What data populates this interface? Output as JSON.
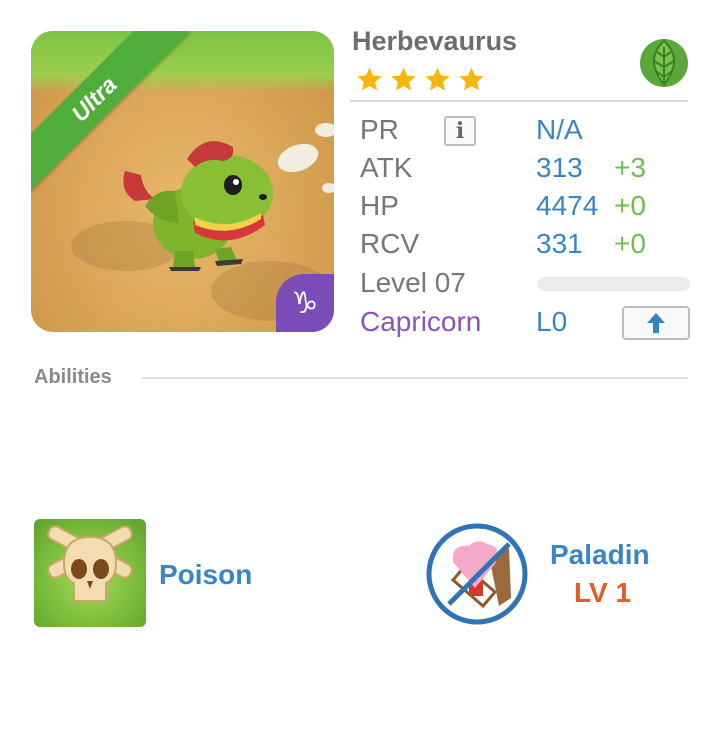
{
  "monster": {
    "name": "Herbevaurus",
    "rarity": "Ultra",
    "stars": 4,
    "element_icon": "leaf-icon",
    "zodiac_symbol": "♑"
  },
  "stats": {
    "pr": {
      "label": "PR",
      "value": "N/A"
    },
    "atk": {
      "label": "ATK",
      "value": "313",
      "bonus": "+3"
    },
    "hp": {
      "label": "HP",
      "value": "4474",
      "bonus": "+0"
    },
    "rcv": {
      "label": "RCV",
      "value": "331",
      "bonus": "+0"
    },
    "level": {
      "label": "Level 07",
      "progress": 0.0
    },
    "zodiac": {
      "label": "Capricorn",
      "value": "L0"
    }
  },
  "abilities": {
    "header": "Abilities",
    "items": [
      {
        "name": "Poison",
        "icon": "skull-crossbones-icon"
      },
      {
        "name": "Paladin",
        "level": "LV 1",
        "icon": "heart-shield-icon"
      }
    ]
  },
  "colors": {
    "stat_value": "#3a86c4",
    "stat_bonus": "#6cc04a",
    "zodiac": "#8a55b8",
    "ultra_ribbon": "#4fae3b",
    "ability_level": "#e35d1f"
  }
}
